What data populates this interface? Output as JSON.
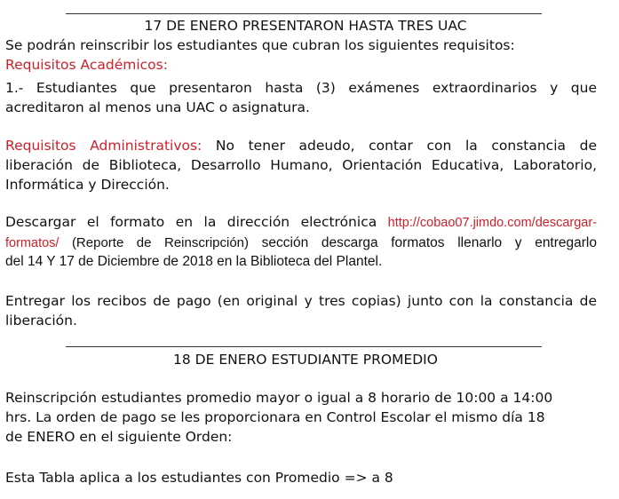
{
  "section1": {
    "heading": "17 DE ENERO PRESENTARON HASTA TRES UAC",
    "intro": "Se podrán reinscribir los estudiantes que cubran los siguientes requisitos:",
    "academic_label": "Requisitos Académicos:",
    "academic_line1": "1.- Estudiantes que presentaron hasta (3) exámenes extraordinarios y que",
    "academic_line2": "acreditaron al menos una UAC o asignatura.",
    "admin_label": "Requisitos Administrativos:",
    "admin_line1_rest": " No tener adeudo, contar con la constancia de",
    "admin_line2": "liberación de Biblioteca, Desarrollo Humano, Orientación Educativa, Laboratorio,",
    "admin_line3": "Informática y Dirección.",
    "download_prefix": "Descargar el formato en la dirección electrónica ",
    "download_link_part1": "http://cobao07.jimdo.com/descargar-",
    "download_link_part2": "formatos/",
    "download_note": " (Reporte de Reinscripción)",
    "download_rest": " sección descarga formatos llenarlo y entregarlo",
    "download_line3": "del 14  Y 17 de Diciembre de 2018 en la Biblioteca del Plantel.",
    "receipts_line1": "Entregar los recibos de pago (en original y tres copias) junto con la constancia de",
    "receipts_line2": "liberación."
  },
  "section2": {
    "heading": "18 DE ENERO ESTUDIANTE PROMEDIO",
    "line1": "Reinscripción estudiantes promedio mayor o igual a 8 horario de 10:00 a 14:00",
    "line2": "hrs. La orden de pago se les proporcionara en Control Escolar el mismo día 18",
    "line3": "de ENERO en el siguiente Orden:",
    "table_note": "Esta Tabla aplica a los estudiantes con Promedio => a 8"
  }
}
